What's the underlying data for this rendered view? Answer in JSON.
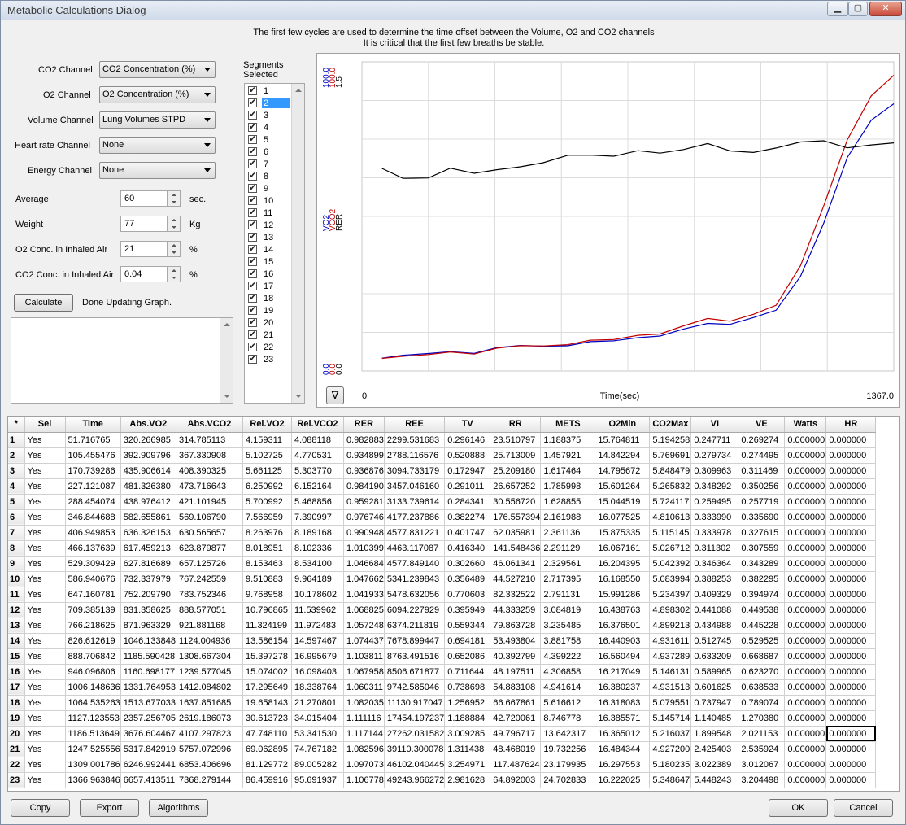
{
  "window": {
    "title": "Metabolic Calculations Dialog",
    "min": "▁",
    "max": "▢",
    "close": "✕"
  },
  "info": {
    "line1": "The first few cycles are used to determine the time offset between the Volume, O2 and CO2 channels",
    "line2": "It is critical that the first few breaths be stable."
  },
  "channels": {
    "co2_label": "CO2 Channel",
    "co2_value": "CO2 Concentration (%)",
    "o2_label": "O2 Channel",
    "o2_value": "O2 Concentration (%)",
    "vol_label": "Volume Channel",
    "vol_value": "Lung Volumes STPD",
    "hr_label": "Heart rate Channel",
    "hr_value": "None",
    "energy_label": "Energy Channel",
    "energy_value": "None"
  },
  "params": {
    "average_label": "Average",
    "average_value": "60",
    "average_unit": "sec.",
    "weight_label": "Weight",
    "weight_value": "77",
    "weight_unit": "Kg",
    "o2_label": "O2 Conc. in Inhaled Air",
    "o2_value": "21",
    "o2_unit": "%",
    "co2_label": "CO2 Conc. in Inhaled Air",
    "co2_value": "0.04",
    "co2_unit": "%"
  },
  "calc": {
    "button": "Calculate",
    "status": "Done Updating Graph."
  },
  "segments": {
    "header1": "Segments",
    "header2": "Selected",
    "selected_index": 2,
    "items": [
      "1",
      "2",
      "3",
      "4",
      "5",
      "6",
      "7",
      "8",
      "9",
      "10",
      "11",
      "12",
      "13",
      "14",
      "15",
      "16",
      "17",
      "18",
      "19",
      "20",
      "21",
      "22",
      "23"
    ]
  },
  "graph": {
    "toggle_icon": "triangle-down-icon",
    "toggle_glyph": "∇"
  },
  "chart_data": {
    "type": "line",
    "xlabel": "Time(sec)",
    "xlim": [
      0,
      1367.0
    ],
    "xtick_left": "0",
    "xtick_right": "1367.0",
    "axes": [
      {
        "label": "VO2",
        "color": "#0000c0",
        "min_label": "0.0",
        "max_label": "100.0"
      },
      {
        "label": "VCO2",
        "color": "#c00000",
        "min_label": "0.0",
        "max_label": "100.0"
      },
      {
        "label": "RER",
        "color": "#000000",
        "min_label": "0.0",
        "max_label": "1.5"
      }
    ],
    "x": [
      51.716765,
      105.455476,
      170.739286,
      227.121087,
      288.454074,
      346.844688,
      406.949853,
      466.137639,
      529.309429,
      586.940676,
      647.160781,
      709.385139,
      766.218625,
      826.612619,
      888.706842,
      946.096806,
      1006.148636,
      1064.535263,
      1127.123553,
      1186.513649,
      1247.525556,
      1309.001786,
      1366.963846
    ],
    "series": [
      {
        "name": "VO2",
        "color": "#0000c0",
        "ymax": 100,
        "values": [
          4.159311,
          5.102725,
          5.661125,
          6.250992,
          5.700992,
          7.566959,
          8.263976,
          8.018951,
          8.153463,
          9.510883,
          9.768958,
          10.796865,
          11.324199,
          13.586154,
          15.397278,
          15.074002,
          17.295649,
          19.658143,
          30.613723,
          47.74811,
          69.062895,
          81.129772,
          86.459916
        ]
      },
      {
        "name": "VCO2",
        "color": "#c00000",
        "ymax": 100,
        "values": [
          4.088118,
          4.770531,
          5.30377,
          6.152164,
          5.468856,
          7.390997,
          8.189168,
          8.102336,
          8.5341,
          9.964189,
          10.178602,
          11.539962,
          11.972483,
          14.597467,
          16.995679,
          16.098403,
          18.338764,
          21.270801,
          34.015404,
          53.34153,
          74.767182,
          89.005282,
          95.691937
        ]
      },
      {
        "name": "RER",
        "color": "#000000",
        "ymax": 1.5,
        "values": [
          0.982883,
          0.934899,
          0.936876,
          0.98419,
          0.959281,
          0.976746,
          0.990948,
          1.010399,
          1.046684,
          1.047662,
          1.041933,
          1.068825,
          1.057248,
          1.074437,
          1.103811,
          1.067958,
          1.060311,
          1.082035,
          1.111116,
          1.117144,
          1.082596,
          1.097073,
          1.106778
        ]
      }
    ]
  },
  "table": {
    "columns": [
      "*",
      "Sel",
      "Time",
      "Abs.VO2",
      "Abs.VCO2",
      "Rel.VO2",
      "Rel.VCO2",
      "RER",
      "REE",
      "TV",
      "RR",
      "METS",
      "O2Min",
      "CO2Max",
      "VI",
      "VE",
      "Watts",
      "HR"
    ],
    "rows": [
      [
        "1",
        "Yes",
        "51.716765",
        "320.266985",
        "314.785113",
        "4.159311",
        "4.088118",
        "0.982883",
        "2299.531683",
        "0.296146",
        "23.510797",
        "1.188375",
        "15.764811",
        "5.194258",
        "0.247711",
        "0.269274",
        "0.000000",
        "0.000000"
      ],
      [
        "2",
        "Yes",
        "105.455476",
        "392.909796",
        "367.330908",
        "5.102725",
        "4.770531",
        "0.934899",
        "2788.116576",
        "0.520888",
        "25.713009",
        "1.457921",
        "14.842294",
        "5.769691",
        "0.279734",
        "0.274495",
        "0.000000",
        "0.000000"
      ],
      [
        "3",
        "Yes",
        "170.739286",
        "435.906614",
        "408.390325",
        "5.661125",
        "5.303770",
        "0.936876",
        "3094.733179",
        "0.172947",
        "25.209180",
        "1.617464",
        "14.795672",
        "5.848479",
        "0.309963",
        "0.311469",
        "0.000000",
        "0.000000"
      ],
      [
        "4",
        "Yes",
        "227.121087",
        "481.326380",
        "473.716643",
        "6.250992",
        "6.152164",
        "0.984190",
        "3457.046160",
        "0.291011",
        "26.657252",
        "1.785998",
        "15.601264",
        "5.265832",
        "0.348292",
        "0.350256",
        "0.000000",
        "0.000000"
      ],
      [
        "5",
        "Yes",
        "288.454074",
        "438.976412",
        "421.101945",
        "5.700992",
        "5.468856",
        "0.959281",
        "3133.739614",
        "0.284341",
        "30.556720",
        "1.628855",
        "15.044519",
        "5.724117",
        "0.259495",
        "0.257719",
        "0.000000",
        "0.000000"
      ],
      [
        "6",
        "Yes",
        "346.844688",
        "582.655861",
        "569.106790",
        "7.566959",
        "7.390997",
        "0.976746",
        "4177.237886",
        "0.382274",
        "176.557394",
        "2.161988",
        "16.077525",
        "4.810613",
        "0.333990",
        "0.335690",
        "0.000000",
        "0.000000"
      ],
      [
        "7",
        "Yes",
        "406.949853",
        "636.326153",
        "630.565657",
        "8.263976",
        "8.189168",
        "0.990948",
        "4577.831221",
        "0.401747",
        "62.035981",
        "2.361136",
        "15.875335",
        "5.115145",
        "0.333978",
        "0.327615",
        "0.000000",
        "0.000000"
      ],
      [
        "8",
        "Yes",
        "466.137639",
        "617.459213",
        "623.879877",
        "8.018951",
        "8.102336",
        "1.010399",
        "4463.117087",
        "0.416340",
        "141.548436",
        "2.291129",
        "16.067161",
        "5.026712",
        "0.311302",
        "0.307559",
        "0.000000",
        "0.000000"
      ],
      [
        "9",
        "Yes",
        "529.309429",
        "627.816689",
        "657.125726",
        "8.153463",
        "8.534100",
        "1.046684",
        "4577.849140",
        "0.302660",
        "46.061341",
        "2.329561",
        "16.204395",
        "5.042392",
        "0.346364",
        "0.343289",
        "0.000000",
        "0.000000"
      ],
      [
        "10",
        "Yes",
        "586.940676",
        "732.337979",
        "767.242559",
        "9.510883",
        "9.964189",
        "1.047662",
        "5341.239843",
        "0.356489",
        "44.527210",
        "2.717395",
        "16.168550",
        "5.083994",
        "0.388253",
        "0.382295",
        "0.000000",
        "0.000000"
      ],
      [
        "11",
        "Yes",
        "647.160781",
        "752.209790",
        "783.752346",
        "9.768958",
        "10.178602",
        "1.041933",
        "5478.632056",
        "0.770603",
        "82.332522",
        "2.791131",
        "15.991286",
        "5.234397",
        "0.409329",
        "0.394974",
        "0.000000",
        "0.000000"
      ],
      [
        "12",
        "Yes",
        "709.385139",
        "831.358625",
        "888.577051",
        "10.796865",
        "11.539962",
        "1.068825",
        "6094.227929",
        "0.395949",
        "44.333259",
        "3.084819",
        "16.438763",
        "4.898302",
        "0.441088",
        "0.449538",
        "0.000000",
        "0.000000"
      ],
      [
        "13",
        "Yes",
        "766.218625",
        "871.963329",
        "921.881168",
        "11.324199",
        "11.972483",
        "1.057248",
        "6374.211819",
        "0.559344",
        "79.863728",
        "3.235485",
        "16.376501",
        "4.899213",
        "0.434988",
        "0.445228",
        "0.000000",
        "0.000000"
      ],
      [
        "14",
        "Yes",
        "826.612619",
        "1046.133848",
        "1124.004936",
        "13.586154",
        "14.597467",
        "1.074437",
        "7678.899447",
        "0.694181",
        "53.493804",
        "3.881758",
        "16.440903",
        "4.931611",
        "0.512745",
        "0.529525",
        "0.000000",
        "0.000000"
      ],
      [
        "15",
        "Yes",
        "888.706842",
        "1185.590428",
        "1308.667304",
        "15.397278",
        "16.995679",
        "1.103811",
        "8763.491516",
        "0.652086",
        "40.392799",
        "4.399222",
        "16.560494",
        "4.937289",
        "0.633209",
        "0.668687",
        "0.000000",
        "0.000000"
      ],
      [
        "16",
        "Yes",
        "946.096806",
        "1160.698177",
        "1239.577045",
        "15.074002",
        "16.098403",
        "1.067958",
        "8506.671877",
        "0.711644",
        "48.197511",
        "4.306858",
        "16.217049",
        "5.146131",
        "0.589965",
        "0.623270",
        "0.000000",
        "0.000000"
      ],
      [
        "17",
        "Yes",
        "1006.148636",
        "1331.764953",
        "1412.084802",
        "17.295649",
        "18.338764",
        "1.060311",
        "9742.585046",
        "0.738698",
        "54.883108",
        "4.941614",
        "16.380237",
        "4.931513",
        "0.601625",
        "0.638533",
        "0.000000",
        "0.000000"
      ],
      [
        "18",
        "Yes",
        "1064.535263",
        "1513.677033",
        "1637.851685",
        "19.658143",
        "21.270801",
        "1.082035",
        "11130.917047",
        "1.256952",
        "66.667861",
        "5.616612",
        "16.318083",
        "5.079551",
        "0.737947",
        "0.789074",
        "0.000000",
        "0.000000"
      ],
      [
        "19",
        "Yes",
        "1127.123553",
        "2357.256705",
        "2619.186073",
        "30.613723",
        "34.015404",
        "1.111116",
        "17454.197237",
        "1.188884",
        "42.720061",
        "8.746778",
        "16.385571",
        "5.145714",
        "1.140485",
        "1.270380",
        "0.000000",
        "0.000000"
      ],
      [
        "20",
        "Yes",
        "1186.513649",
        "3676.604467",
        "4107.297823",
        "47.748110",
        "53.341530",
        "1.117144",
        "27262.031582",
        "3.009285",
        "49.796717",
        "13.642317",
        "16.365012",
        "5.216037",
        "1.899548",
        "2.021153",
        "0.000000",
        "0.000000"
      ],
      [
        "21",
        "Yes",
        "1247.525556",
        "5317.842919",
        "5757.072996",
        "69.062895",
        "74.767182",
        "1.082596",
        "39110.300078",
        "1.311438",
        "48.468019",
        "19.732256",
        "16.484344",
        "4.927200",
        "2.425403",
        "2.535924",
        "0.000000",
        "0.000000"
      ],
      [
        "22",
        "Yes",
        "1309.001786",
        "6246.992441",
        "6853.406696",
        "81.129772",
        "89.005282",
        "1.097073",
        "46102.040445",
        "3.254971",
        "117.487624",
        "23.179935",
        "16.297553",
        "5.180235",
        "3.022389",
        "3.012067",
        "0.000000",
        "0.000000"
      ],
      [
        "23",
        "Yes",
        "1366.963846",
        "6657.413511",
        "7368.279144",
        "86.459916",
        "95.691937",
        "1.106778",
        "49243.966272",
        "2.981628",
        "64.892003",
        "24.702833",
        "16.222025",
        "5.348647",
        "5.448243",
        "3.204498",
        "0.000000",
        "0.000000"
      ]
    ]
  },
  "buttons": {
    "copy": "Copy",
    "export": "Export",
    "algorithms": "Algorithms",
    "ok": "OK",
    "cancel": "Cancel"
  }
}
